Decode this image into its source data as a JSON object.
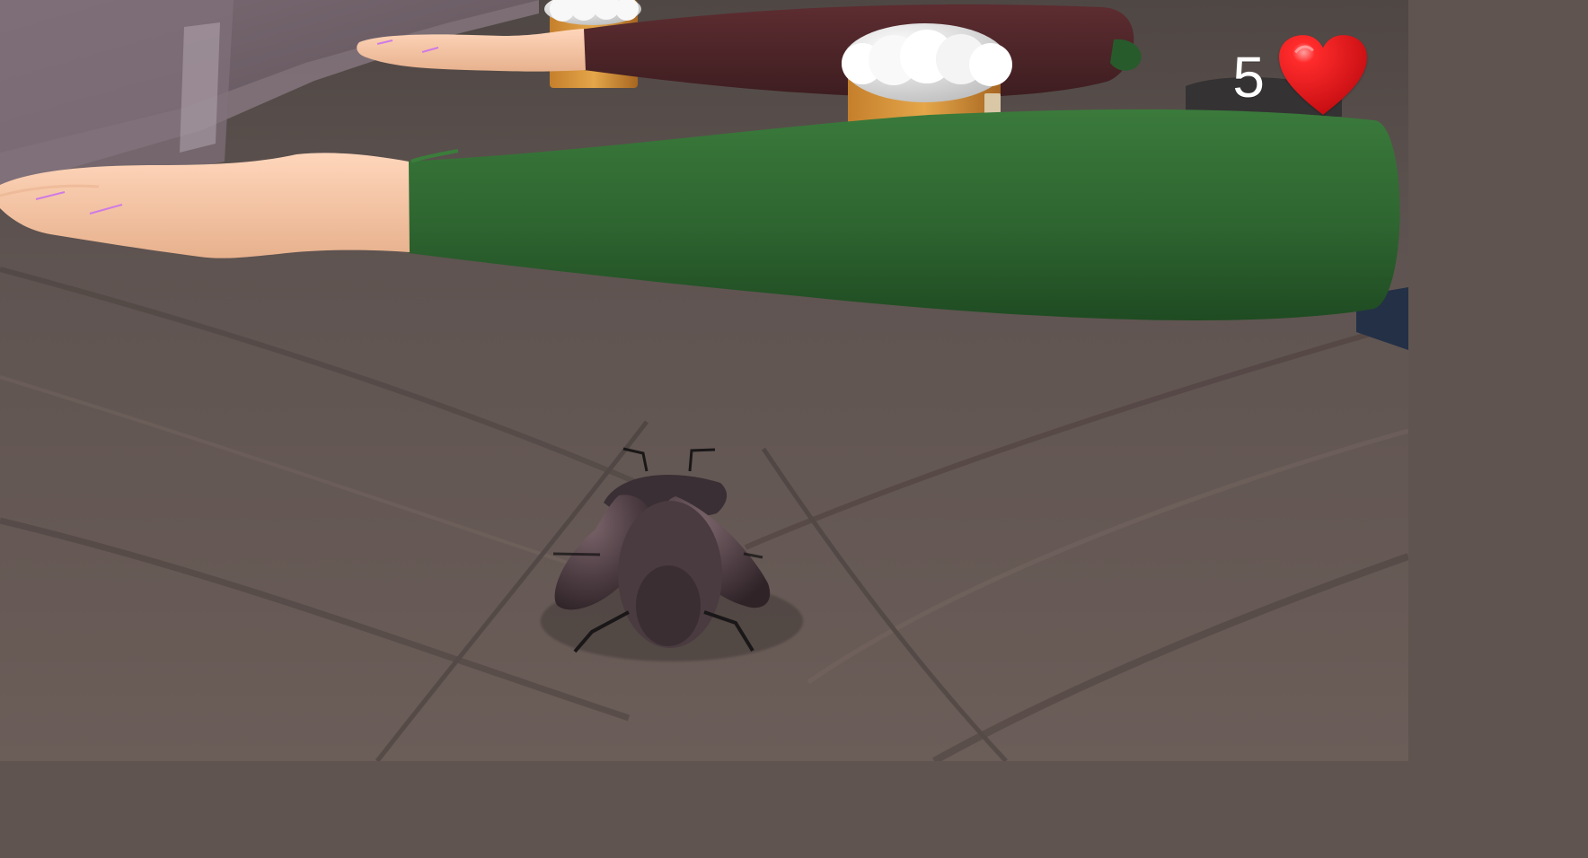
{
  "hud": {
    "lives": "5",
    "lives_icon": "heart-icon"
  },
  "scene": {
    "player": "cockroach",
    "obstacles": [
      "reaching-hand-green-sleeve",
      "reaching-hand-maroon-sleeve",
      "beer-mug"
    ],
    "surface": "wooden-table"
  },
  "colors": {
    "table": "#5f524d",
    "wall": "#6f5f68",
    "sleeve_green": "#2d5f2f",
    "sleeve_maroon": "#4b2326",
    "skin": "#f0c6a6",
    "heart": "#e3141a",
    "hud_text": "#ffffff"
  }
}
